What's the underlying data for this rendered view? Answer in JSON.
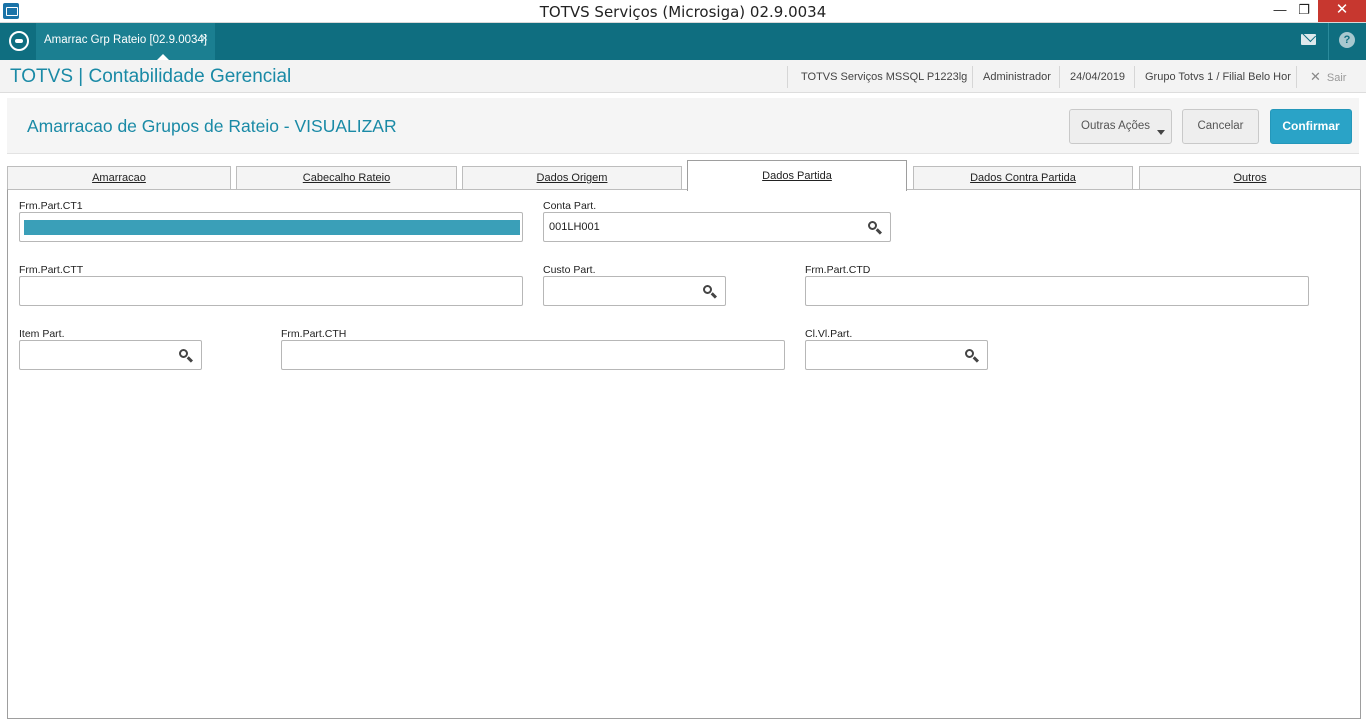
{
  "window": {
    "title": "TOTVS Serviços (Microsiga) 02.9.0034",
    "minimize": "—",
    "maximize": "❐",
    "close": "✕"
  },
  "appbar": {
    "tab_label": "Amarrac Grp Rateio [02.9.0034]",
    "tab_close": "×",
    "help": "?"
  },
  "module": {
    "title": "TOTVS | Contabilidade Gerencial",
    "environment": "TOTVS Serviços MSSQL P1223lg",
    "user": "Administrador",
    "date": "24/04/2019",
    "branch": "Grupo Totvs 1 / Filial Belo Hor",
    "exit_label": "Sair"
  },
  "page": {
    "title": "Amarracao de Grupos de Rateio - VISUALIZAR",
    "more_actions": "Outras Ações",
    "cancel": "Cancelar",
    "confirm": "Confirmar"
  },
  "tabs": [
    "Amarracao",
    "Cabecalho Rateio",
    "Dados Origem",
    "Dados Partida",
    "Dados Contra Partida",
    "Outros"
  ],
  "active_tab": "Dados Partida",
  "fields": {
    "frm_part_ct1": {
      "label": "Frm.Part.CT1",
      "value": ""
    },
    "conta_part": {
      "label": "Conta Part.",
      "value": "001LH001"
    },
    "frm_part_ctt": {
      "label": "Frm.Part.CTT",
      "value": ""
    },
    "custo_part": {
      "label": "Custo Part.",
      "value": ""
    },
    "frm_part_ctd": {
      "label": "Frm.Part.CTD",
      "value": ""
    },
    "item_part": {
      "label": "Item Part.",
      "value": ""
    },
    "frm_part_cth": {
      "label": "Frm.Part.CTH",
      "value": ""
    },
    "cl_vl_part": {
      "label": "Cl.Vl.Part.",
      "value": ""
    }
  },
  "colors": {
    "appbar": "#0f6e80",
    "accent": "#1a8aa6",
    "confirm_button": "#2aa3c7",
    "close_button": "#c7372f"
  },
  "icons": {
    "app": "app-icon",
    "logo": "totvs-logo-icon",
    "mail": "mail-icon",
    "help": "help-icon",
    "search": "search-icon",
    "exit": "close-icon",
    "dropdown": "caret-down-icon"
  }
}
